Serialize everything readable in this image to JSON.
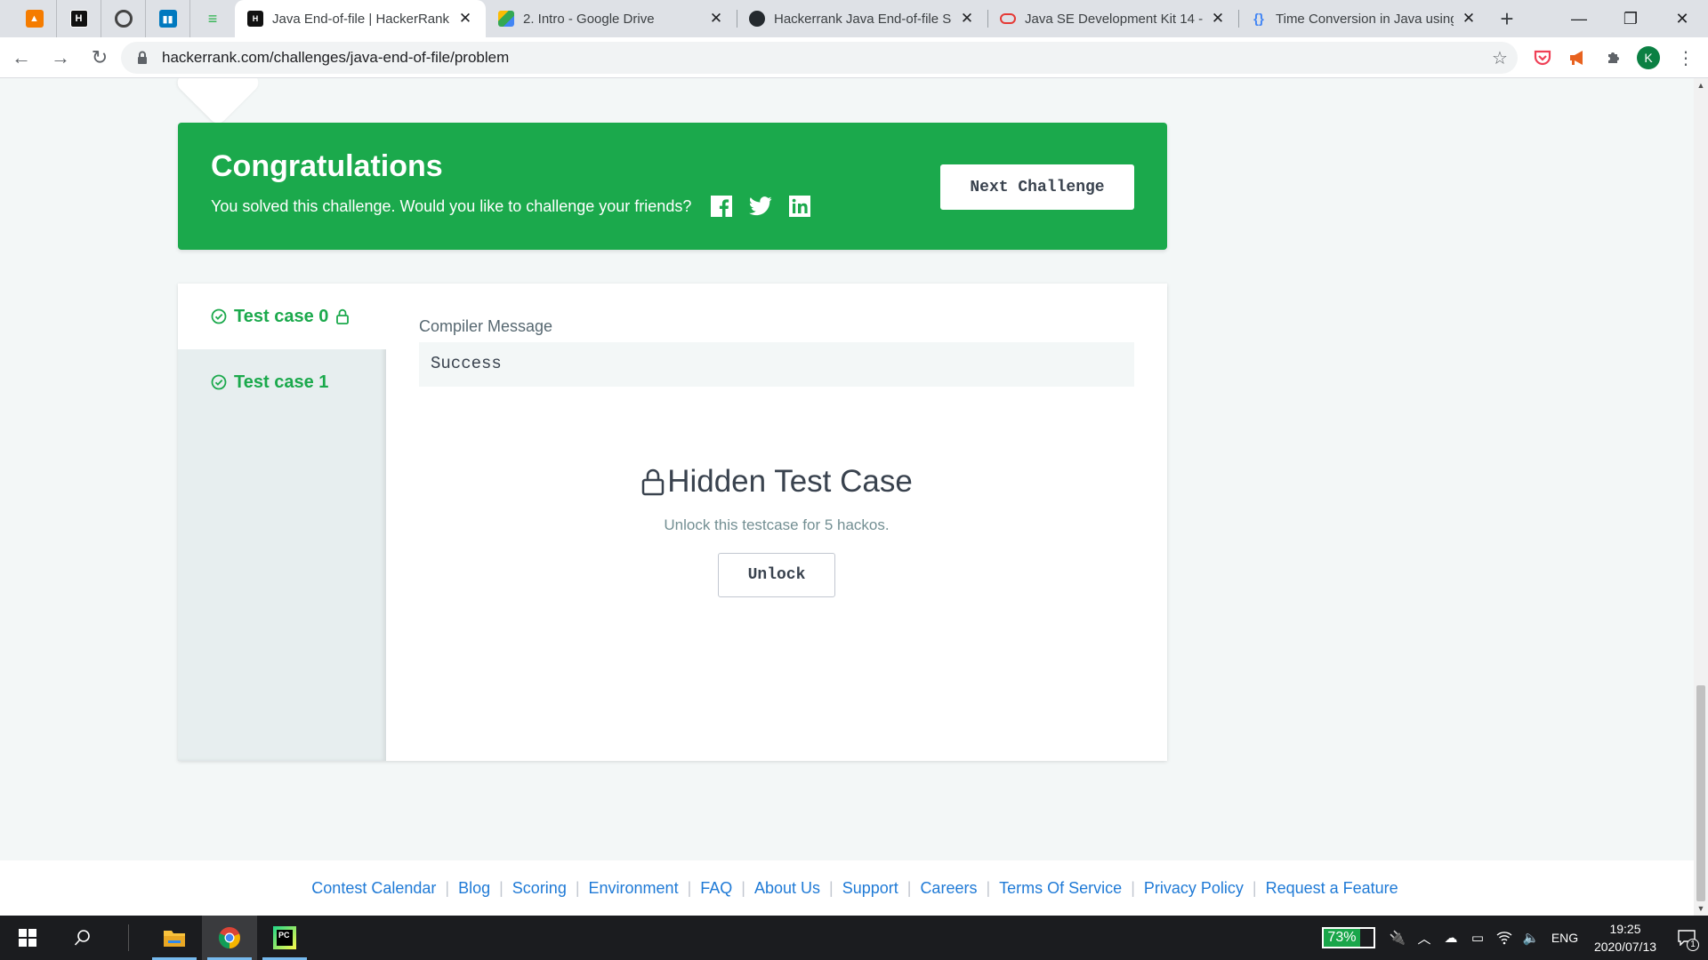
{
  "browser": {
    "tabs": [
      {
        "title": "Java End-of-file | HackerRank",
        "active": true
      },
      {
        "title": "2. Intro - Google Drive",
        "active": false
      },
      {
        "title": "Hackerrank Java End-of-file So",
        "active": false
      },
      {
        "title": "Java SE Development Kit 14 - ",
        "active": false
      },
      {
        "title": "Time Conversion in Java using",
        "active": false
      }
    ],
    "url": "hackerrank.com/challenges/java-end-of-file/problem",
    "profile_initial": "K",
    "pinned_icons": [
      "orange-app-icon",
      "hackerrank-icon",
      "circle-app-icon",
      "trello-icon",
      "feedly-icon"
    ]
  },
  "banner": {
    "title": "Congratulations",
    "subtitle": "You solved this challenge. Would you like to challenge your friends?",
    "next_button": "Next Challenge",
    "color": "#1ba94c"
  },
  "test_cases": [
    {
      "label": "Test case 0",
      "locked": true,
      "passed": true
    },
    {
      "label": "Test case 1",
      "locked": false,
      "passed": true
    }
  ],
  "compiler": {
    "label": "Compiler Message",
    "message": "Success"
  },
  "hidden": {
    "title": "Hidden Test Case",
    "description": "Unlock this testcase for 5 hackos.",
    "button": "Unlock"
  },
  "footer": {
    "links": [
      "Contest Calendar",
      "Blog",
      "Scoring",
      "Environment",
      "FAQ",
      "About Us",
      "Support",
      "Careers",
      "Terms Of Service",
      "Privacy Policy",
      "Request a Feature"
    ]
  },
  "taskbar": {
    "battery_percent": "73%",
    "battery_level": 0.73,
    "language": "ENG",
    "time": "19:25",
    "date": "2020/07/13",
    "notification_count": "1"
  }
}
